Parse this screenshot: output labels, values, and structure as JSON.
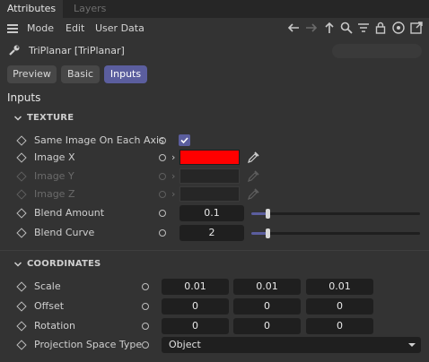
{
  "tabs": [
    {
      "label": "Attributes",
      "active": true
    },
    {
      "label": "Layers",
      "active": false
    }
  ],
  "menu": {
    "items": [
      "Mode",
      "Edit",
      "User Data"
    ]
  },
  "toolbar_icons": [
    "back-arrow-icon",
    "forward-arrow-icon",
    "up-arrow-icon",
    "search-icon",
    "filter-icon",
    "lock-icon",
    "target-icon",
    "new-window-icon"
  ],
  "object": {
    "name": "TriPlanar [TriPlanar]"
  },
  "modes": [
    {
      "label": "Preview",
      "active": false
    },
    {
      "label": "Basic",
      "active": false
    },
    {
      "label": "Inputs",
      "active": true
    }
  ],
  "section_title": "Inputs",
  "texture": {
    "title": "TEXTURE",
    "same_image": {
      "label": "Same Image On Each Axis",
      "checked": true
    },
    "image_x": {
      "label": "Image X",
      "color": "#ff0000"
    },
    "image_y": {
      "label": "Image Y"
    },
    "image_z": {
      "label": "Image Z"
    },
    "blend_amount": {
      "label": "Blend Amount",
      "value": "0.1",
      "level": 0.1
    },
    "blend_curve": {
      "label": "Blend Curve",
      "value": "2",
      "level": 0.1
    }
  },
  "coordinates": {
    "title": "COORDINATES",
    "scale": {
      "label": "Scale",
      "values": [
        "0.01",
        "0.01",
        "0.01"
      ]
    },
    "offset": {
      "label": "Offset",
      "values": [
        "0",
        "0",
        "0"
      ]
    },
    "rotation": {
      "label": "Rotation",
      "values": [
        "0",
        "0",
        "0"
      ]
    },
    "projection": {
      "label": "Projection Space Type",
      "value": "Object"
    }
  },
  "colors": {
    "accent": "#5b5e9e",
    "background": "#333333",
    "field": "#1f1f1f"
  }
}
